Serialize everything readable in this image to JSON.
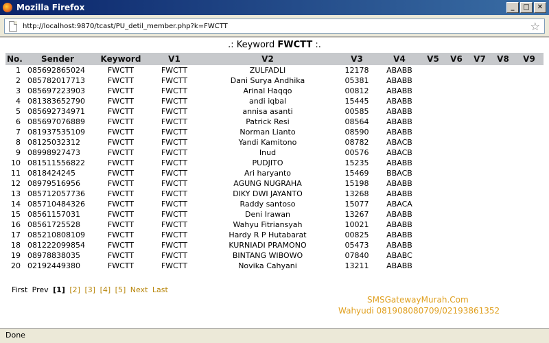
{
  "window": {
    "title": "Mozilla Firefox",
    "minimize_glyph": "_",
    "maximize_glyph": "□",
    "close_glyph": "✕"
  },
  "urlbar": {
    "url": "http://localhost:9870/tcast/PU_detil_member.php?k=FWCTT",
    "bookmark_icon": "☆"
  },
  "heading": {
    "prefix": ".: Keyword ",
    "keyword": "FWCTT",
    "suffix": " :."
  },
  "table": {
    "columns": [
      "No.",
      "Sender",
      "Keyword",
      "V1",
      "V2",
      "V3",
      "V4",
      "V5",
      "V6",
      "V7",
      "V8",
      "V9"
    ],
    "rows": [
      [
        "1",
        "085692865024",
        "FWCTT",
        "FWCTT",
        "ZULFADLI",
        "12178",
        "ABABB",
        "",
        "",
        "",
        "",
        ""
      ],
      [
        "2",
        "085782017713",
        "FWCTT",
        "FWCTT",
        "Dani Surya Andhika",
        "05381",
        "ABABB",
        "",
        "",
        "",
        "",
        ""
      ],
      [
        "3",
        "085697223903",
        "FWCTT",
        "FWCTT",
        "Arinal Haqqo",
        "00812",
        "ABABB",
        "",
        "",
        "",
        "",
        ""
      ],
      [
        "4",
        "081383652790",
        "FWCTT",
        "FWCTT",
        "andi iqbal",
        "15445",
        "ABABB",
        "",
        "",
        "",
        "",
        ""
      ],
      [
        "5",
        "085692734971",
        "FWCTT",
        "FWCTT",
        "annisa asanti",
        "00585",
        "ABABB",
        "",
        "",
        "",
        "",
        ""
      ],
      [
        "6",
        "085697076889",
        "FWCTT",
        "FWCTT",
        "Patrick Resi",
        "08564",
        "ABABB",
        "",
        "",
        "",
        "",
        ""
      ],
      [
        "7",
        "081937535109",
        "FWCTT",
        "FWCTT",
        "Norman Lianto",
        "08590",
        "ABABB",
        "",
        "",
        "",
        "",
        ""
      ],
      [
        "8",
        "08125032312",
        "FWCTT",
        "FWCTT",
        "Yandi Kamitono",
        "08782",
        "ABACB",
        "",
        "",
        "",
        "",
        ""
      ],
      [
        "9",
        "08998927473",
        "FWCTT",
        "FWCTT",
        "Inud",
        "00576",
        "ABACB",
        "",
        "",
        "",
        "",
        ""
      ],
      [
        "10",
        "081511556822",
        "FWCTT",
        "FWCTT",
        "PUDJITO",
        "15235",
        "ABABB",
        "",
        "",
        "",
        "",
        ""
      ],
      [
        "11",
        "0818424245",
        "FWCTT",
        "FWCTT",
        "Ari haryanto",
        "15469",
        "BBACB",
        "",
        "",
        "",
        "",
        ""
      ],
      [
        "12",
        "08979516956",
        "FWCTT",
        "FWCTT",
        "AGUNG NUGRAHA",
        "15198",
        "ABABB",
        "",
        "",
        "",
        "",
        ""
      ],
      [
        "13",
        "085712057736",
        "FWCTT",
        "FWCTT",
        "DIKY DWI JAYANTO",
        "13268",
        "ABABB",
        "",
        "",
        "",
        "",
        ""
      ],
      [
        "14",
        "085710484326",
        "FWCTT",
        "FWCTT",
        "Raddy santoso",
        "15077",
        "ABACA",
        "",
        "",
        "",
        "",
        ""
      ],
      [
        "15",
        "08561157031",
        "FWCTT",
        "FWCTT",
        "Deni Irawan",
        "13267",
        "ABABB",
        "",
        "",
        "",
        "",
        ""
      ],
      [
        "16",
        "08561725528",
        "FWCTT",
        "FWCTT",
        "Wahyu Fitriansyah",
        "10021",
        "ABABB",
        "",
        "",
        "",
        "",
        ""
      ],
      [
        "17",
        "085210808109",
        "FWCTT",
        "FWCTT",
        "Hardy R P Hutabarat",
        "00825",
        "ABABB",
        "",
        "",
        "",
        "",
        ""
      ],
      [
        "18",
        "081222099854",
        "FWCTT",
        "FWCTT",
        "KURNIADI PRAMONO",
        "05473",
        "ABABB",
        "",
        "",
        "",
        "",
        ""
      ],
      [
        "19",
        "08978838035",
        "FWCTT",
        "FWCTT",
        "BINTANG WIBOWO",
        "07840",
        "ABABC",
        "",
        "",
        "",
        "",
        ""
      ],
      [
        "20",
        "02192449380",
        "FWCTT",
        "FWCTT",
        "Novika Cahyani",
        "13211",
        "ABABB",
        "",
        "",
        "",
        "",
        ""
      ]
    ]
  },
  "pager": {
    "first": "First",
    "prev": "Prev",
    "current": "[1]",
    "pages": [
      "[2]",
      "[3]",
      "[4]",
      "[5]"
    ],
    "next": "Next",
    "last": "Last"
  },
  "footer": {
    "line1": "SMSGatewayMurah.Com",
    "line2": "Wahyudi 081908080709/02193861352"
  },
  "statusbar": {
    "text": "Done"
  },
  "colors": {
    "title_gradient_start": "#0a246a",
    "header_row_bg": "#c7c9cc",
    "footer_text": "#e0a020",
    "pager_link": "#b8860b"
  }
}
